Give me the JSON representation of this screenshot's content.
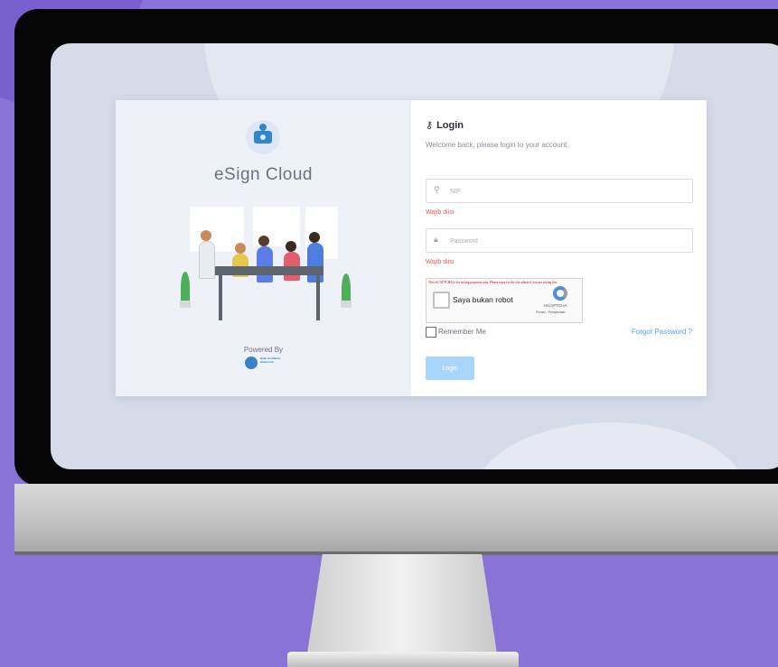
{
  "login_panel": {
    "title": "Login",
    "key_icon": "⚷",
    "welcome": "Welcome back, please login to your account.",
    "nip": {
      "placeholder": "NIP",
      "icon": "user-icon",
      "error": "Wajib diisi"
    },
    "password": {
      "placeholder": "Password",
      "icon": "lock-icon",
      "error": "Wajib diisi"
    },
    "captcha": {
      "warning": "This reCAPTCHA is for testing purposes only. Please report to the site admin if you are seeing this.",
      "label": "Saya bukan robot",
      "brand": "reCAPTCHA",
      "privacy": "Privasi - Persyaratan"
    },
    "remember_label": "Remember Me",
    "forgot_label": "Forgot Password ?",
    "login_button": "Login"
  },
  "brand_panel": {
    "app_name": "eSign Cloud",
    "powered_by": "Powered By",
    "partner_logo_text": "Balai Sertifikasi Elektronik"
  },
  "colors": {
    "background": "#8a73d6",
    "accent": "#55a4ea",
    "error": "#e35d5d",
    "button": "#a8d6fb"
  }
}
